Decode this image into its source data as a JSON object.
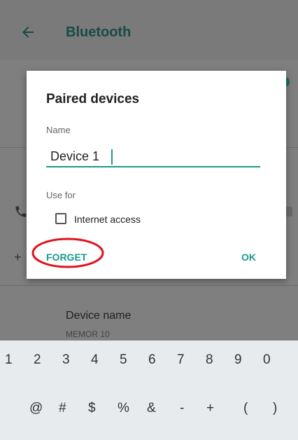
{
  "header": {
    "title": "Bluetooth"
  },
  "background": {
    "device_name_label": "Device name",
    "device_name_value": "MEMOR 10"
  },
  "dialog": {
    "title": "Paired devices",
    "name_label": "Name",
    "name_value": "Device 1",
    "use_for_label": "Use for",
    "checkbox_label": "Internet access",
    "checkbox_checked": false,
    "forget_label": "FORGET",
    "ok_label": "OK"
  },
  "keyboard": {
    "row1": [
      "1",
      "2",
      "3",
      "4",
      "5",
      "6",
      "7",
      "8",
      "9",
      "0"
    ],
    "row2": [
      "@",
      "#",
      "$",
      "%",
      "&",
      "-",
      "+",
      "(",
      ")"
    ]
  },
  "colors": {
    "accent": "#1a9a8b",
    "annotation": "#e0141e"
  }
}
